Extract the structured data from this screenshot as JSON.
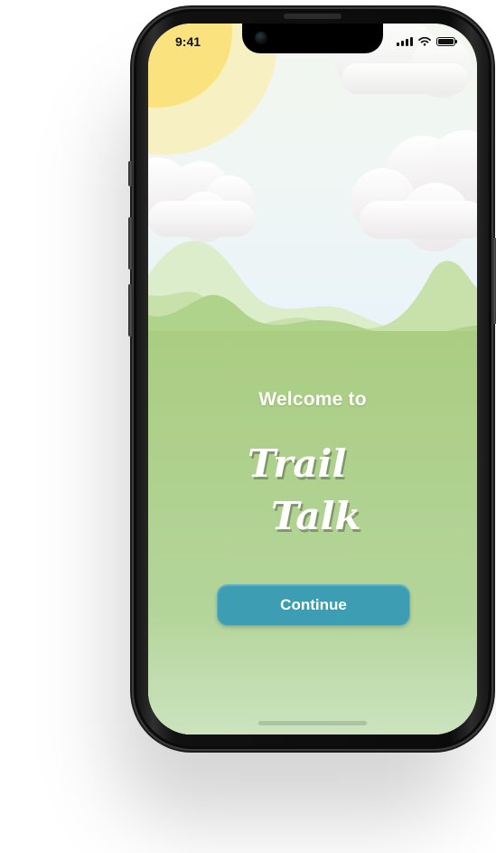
{
  "device": {
    "status_bar": {
      "time": "9:41",
      "icons": [
        "signal-icon",
        "wifi-icon",
        "battery-icon"
      ]
    }
  },
  "screen": {
    "welcome": "Welcome to",
    "brand": {
      "line1": "Trail",
      "line2": "Talk"
    },
    "continue_label": "Continue"
  },
  "colors": {
    "sky": "#e8f3fb",
    "grass": "#a9d081",
    "hills_light": "#cfe4b4",
    "hills_mid": "#b7d79a",
    "button": "#3d9db2",
    "sun": "#f7e27e"
  }
}
